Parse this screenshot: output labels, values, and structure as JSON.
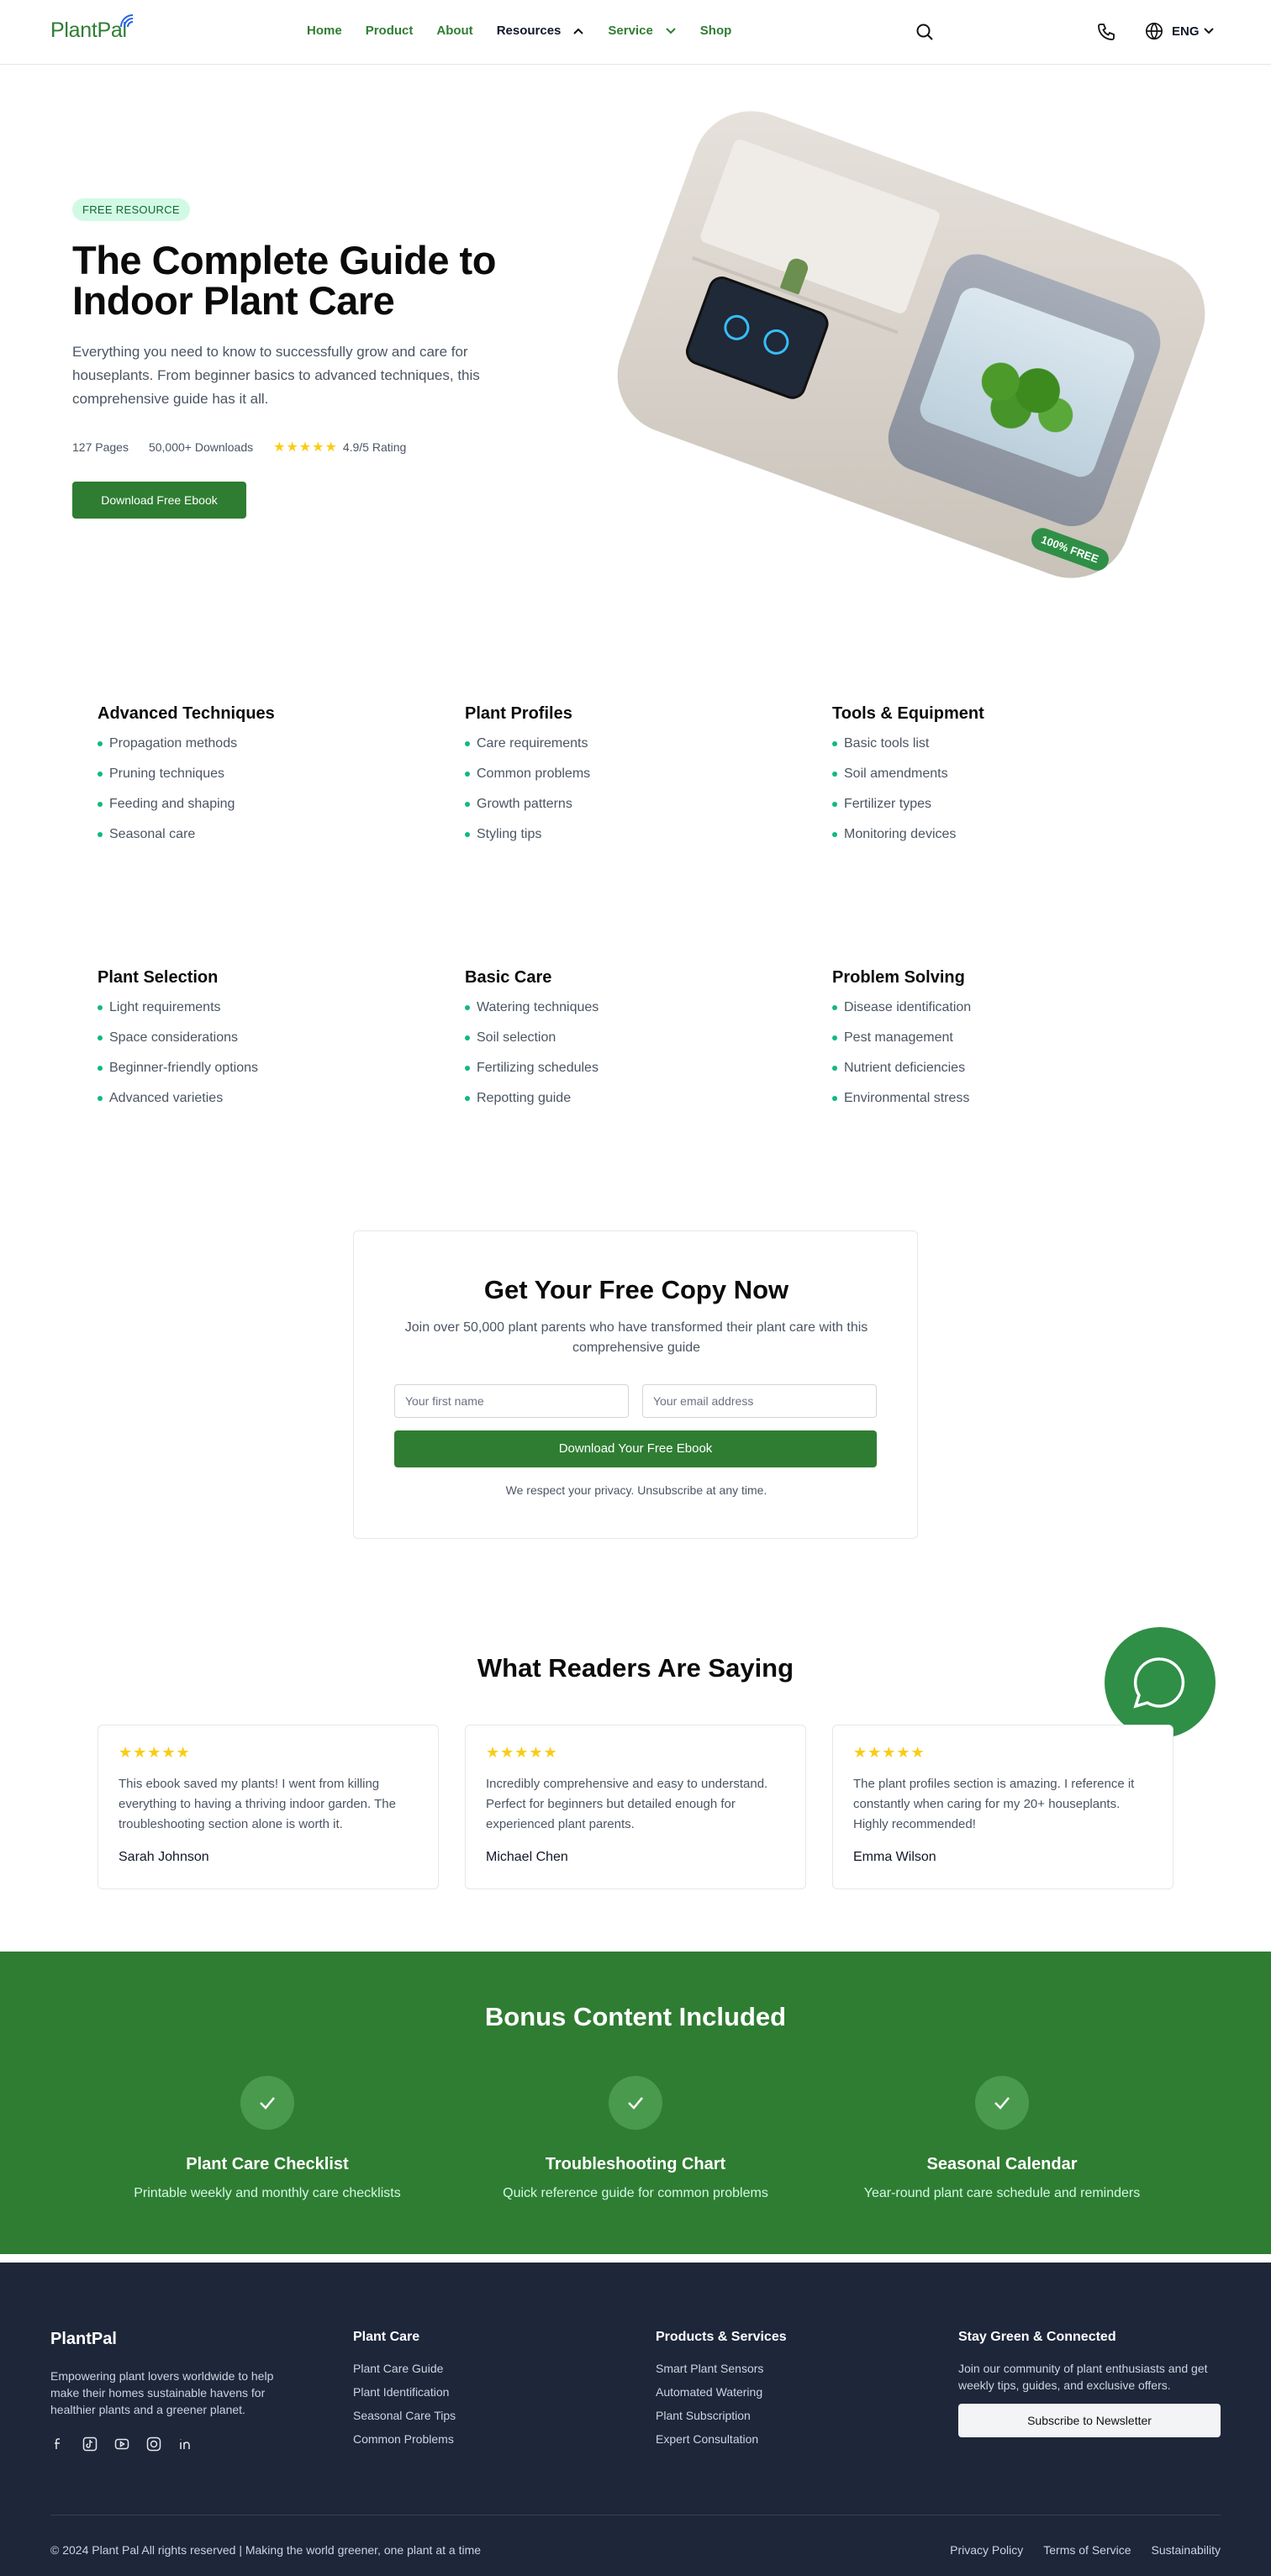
{
  "nav": {
    "logo": "PlantPal",
    "links": [
      "Home",
      "Product",
      "About",
      "Resources",
      "Service",
      "Shop"
    ],
    "lang": "ENG"
  },
  "hero": {
    "badge": "FREE RESOURCE",
    "title": "The Complete Guide to Indoor Plant Care",
    "description": "Everything you need to know to successfully grow and care for houseplants. From beginner basics to advanced techniques, this comprehensive guide has it all.",
    "pages": "127 Pages",
    "downloads": "50,000+ Downloads",
    "stars": "★★★★★",
    "rating": "4.9/5 Rating",
    "button": "Download Free Ebook",
    "free_tag": "100% FREE"
  },
  "topics": [
    {
      "title": "Advanced Techniques",
      "items": [
        "Propagation methods",
        "Pruning techniques",
        "Feeding and shaping",
        "Seasonal care"
      ]
    },
    {
      "title": "Plant Profiles",
      "items": [
        "Care requirements",
        "Common problems",
        "Growth patterns",
        "Styling tips"
      ]
    },
    {
      "title": "Tools & Equipment",
      "items": [
        "Basic tools list",
        "Soil amendments",
        "Fertilizer types",
        "Monitoring devices"
      ]
    },
    {
      "title": "Plant Selection",
      "items": [
        "Light requirements",
        "Space considerations",
        "Beginner-friendly options",
        "Advanced varieties"
      ]
    },
    {
      "title": "Basic Care",
      "items": [
        "Watering techniques",
        "Soil selection",
        "Fertilizing schedules",
        "Repotting guide"
      ]
    },
    {
      "title": "Problem Solving",
      "items": [
        "Disease identification",
        "Pest management",
        "Nutrient deficiencies",
        "Environmental stress"
      ]
    }
  ],
  "form": {
    "title": "Get Your Free Copy Now",
    "subtitle": "Join over 50,000 plant parents who have transformed their plant care with this comprehensive guide",
    "first_name_placeholder": "Your first name",
    "email_placeholder": "Your email address",
    "button": "Download Your Free Ebook",
    "privacy": "We respect your privacy. Unsubscribe at any time."
  },
  "testimonials": {
    "title": "What Readers Are Saying",
    "items": [
      {
        "stars": "★★★★★",
        "text": "This ebook saved my plants! I went from killing everything to having a thriving indoor garden. The troubleshooting section alone is worth it.",
        "name": "Sarah Johnson"
      },
      {
        "stars": "★★★★★",
        "text": "Incredibly comprehensive and easy to understand. Perfect for beginners but detailed enough for experienced plant parents.",
        "name": "Michael Chen"
      },
      {
        "stars": "★★★★★",
        "text": "The plant profiles section is amazing. I reference it constantly when caring for my 20+ houseplants. Highly recommended!",
        "name": "Emma Wilson"
      }
    ]
  },
  "bonus": {
    "title": "Bonus Content Included",
    "items": [
      {
        "title": "Plant Care Checklist",
        "desc": "Printable weekly and monthly care checklists"
      },
      {
        "title": "Troubleshooting Chart",
        "desc": "Quick reference guide for common problems"
      },
      {
        "title": "Seasonal Calendar",
        "desc": "Year-round plant care schedule and reminders"
      }
    ]
  },
  "footer": {
    "logo": "PlantPal",
    "description": "Empowering plant lovers worldwide to help make their homes sustainable havens for healthier plants and a greener planet.",
    "col1": {
      "title": "Plant Care",
      "links": [
        "Plant Care Guide",
        "Plant Identification",
        "Seasonal Care Tips",
        "Common Problems"
      ]
    },
    "col2": {
      "title": "Products & Services",
      "links": [
        "Smart Plant Sensors",
        "Automated Watering",
        "Plant Subscription",
        "Expert Consultation"
      ]
    },
    "newsletter": {
      "title": "Stay Green & Connected",
      "desc": "Join our community of plant enthusiasts and get weekly tips, guides, and exclusive offers.",
      "button": "Subscribe to Newsletter"
    },
    "copyright": "© 2024 Plant Pal   All rights reserved | Making the world greener, one plant at a time",
    "legal": [
      "Privacy Policy",
      "Terms of Service",
      "Sustainability"
    ]
  },
  "colors": {
    "brand_green": "#2f7d32",
    "accent_mint": "#d1fae5",
    "footer_bg": "#1e2639",
    "star": "#facc15"
  },
  "icons": [
    "wifi-icon",
    "chevron-up-icon",
    "chevron-down-icon",
    "search-icon",
    "phone-icon",
    "globe-icon",
    "chat-icon",
    "check-icon",
    "facebook-icon",
    "tiktok-icon",
    "youtube-icon",
    "instagram-icon",
    "linkedin-icon"
  ]
}
